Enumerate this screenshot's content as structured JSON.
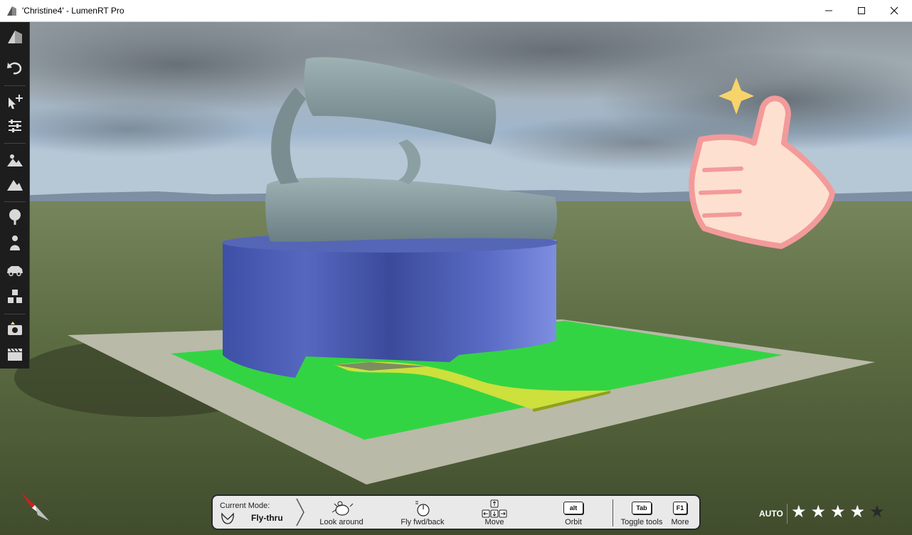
{
  "window": {
    "title": "'Christine4' - LumenRT Pro",
    "minimize_icon": "minimize-icon",
    "maximize_icon": "maximize-icon",
    "close_icon": "close-icon"
  },
  "toolbar": {
    "tools": [
      {
        "name": "project-icon"
      },
      {
        "name": "undo-icon"
      },
      {
        "name": "select-move-icon"
      },
      {
        "name": "properties-sliders-icon"
      },
      {
        "name": "sky-environment-icon"
      },
      {
        "name": "terrain-icon"
      },
      {
        "name": "plants-icon"
      },
      {
        "name": "people-icon"
      },
      {
        "name": "vehicle-icon"
      },
      {
        "name": "objects-icon"
      },
      {
        "name": "photo-icon"
      },
      {
        "name": "movie-clapper-icon"
      }
    ]
  },
  "hintbar": {
    "current_mode_label": "Current Mode:",
    "current_mode_value": "Fly-thru",
    "hints": [
      {
        "label": "Look around",
        "icon": "mouse-look-icon"
      },
      {
        "label": "Fly fwd/back",
        "icon": "mouse-scroll-icon"
      },
      {
        "label": "Move",
        "icon": "arrow-keys-icon"
      },
      {
        "label": "Orbit",
        "key": "alt"
      },
      {
        "label": "Toggle tools",
        "key": "Tab"
      },
      {
        "label": "More",
        "key": "F1"
      }
    ]
  },
  "quality": {
    "label": "AUTO",
    "rating": 4,
    "max": 5
  },
  "colors": {
    "accent_green": "#33d443",
    "path_yellow": "#cde03c",
    "building_blue": "#4a59b0",
    "ribbon_grey": "#7f9598",
    "compass_red": "#d21f1f"
  }
}
